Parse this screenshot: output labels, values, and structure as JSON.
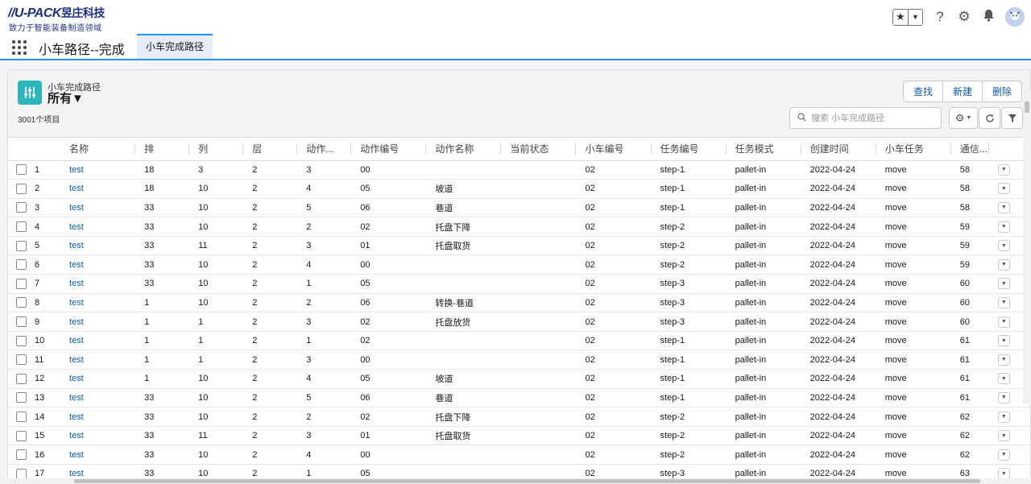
{
  "brand": {
    "name": "U-PACK",
    "name_cn": "昱庄科技",
    "tagline": "致力于智能装备制造领域"
  },
  "header": {
    "star_glyph": "★",
    "dropdown_glyph": "▼",
    "help_glyph": "?",
    "gear_glyph": "⚙",
    "bell_glyph": "🔔"
  },
  "nav": {
    "app_name": "小车路径--完成",
    "active_tab": "小车完成路径"
  },
  "list": {
    "object_type": "小车完成路径",
    "view_name": "所有▼",
    "count": "3001个项目",
    "buttons": {
      "find": "查找",
      "new": "新建",
      "delete": "删除"
    },
    "search_placeholder": "搜索 小车完成路径"
  },
  "table": {
    "columns": [
      "名称",
      "排",
      "列",
      "层",
      "动作...",
      "动作编号",
      "动作名称",
      "当前状态",
      "小车编号",
      "任务编号",
      "任务模式",
      "创建时间",
      "小车任务",
      "通信..."
    ],
    "rows": [
      [
        "1",
        "test",
        "18",
        "3",
        "2",
        "3",
        "00",
        "",
        "",
        "02",
        "step-1",
        "pallet-in",
        "2022-04-24",
        "move",
        "58"
      ],
      [
        "2",
        "test",
        "18",
        "10",
        "2",
        "4",
        "05",
        "坡道",
        "",
        "02",
        "step-1",
        "pallet-in",
        "2022-04-24",
        "move",
        "58"
      ],
      [
        "3",
        "test",
        "33",
        "10",
        "2",
        "5",
        "06",
        "巷道",
        "",
        "02",
        "step-1",
        "pallet-in",
        "2022-04-24",
        "move",
        "58"
      ],
      [
        "4",
        "test",
        "33",
        "10",
        "2",
        "2",
        "02",
        "托盘下降",
        "",
        "02",
        "step-2",
        "pallet-in",
        "2022-04-24",
        "move",
        "59"
      ],
      [
        "5",
        "test",
        "33",
        "11",
        "2",
        "3",
        "01",
        "托盘取货",
        "",
        "02",
        "step-2",
        "pallet-in",
        "2022-04-24",
        "move",
        "59"
      ],
      [
        "6",
        "test",
        "33",
        "10",
        "2",
        "4",
        "00",
        "",
        "",
        "02",
        "step-2",
        "pallet-in",
        "2022-04-24",
        "move",
        "59"
      ],
      [
        "7",
        "test",
        "33",
        "10",
        "2",
        "1",
        "05",
        "",
        "",
        "02",
        "step-3",
        "pallet-in",
        "2022-04-24",
        "move",
        "60"
      ],
      [
        "8",
        "test",
        "1",
        "10",
        "2",
        "2",
        "06",
        "转换-巷道",
        "",
        "02",
        "step-3",
        "pallet-in",
        "2022-04-24",
        "move",
        "60"
      ],
      [
        "9",
        "test",
        "1",
        "1",
        "2",
        "3",
        "02",
        "托盘放货",
        "",
        "02",
        "step-3",
        "pallet-in",
        "2022-04-24",
        "move",
        "60"
      ],
      [
        "10",
        "test",
        "1",
        "1",
        "2",
        "1",
        "02",
        "",
        "",
        "02",
        "step-1",
        "pallet-in",
        "2022-04-24",
        "move",
        "61"
      ],
      [
        "11",
        "test",
        "1",
        "1",
        "2",
        "3",
        "00",
        "",
        "",
        "02",
        "step-1",
        "pallet-in",
        "2022-04-24",
        "move",
        "61"
      ],
      [
        "12",
        "test",
        "1",
        "10",
        "2",
        "4",
        "05",
        "坡道",
        "",
        "02",
        "step-1",
        "pallet-in",
        "2022-04-24",
        "move",
        "61"
      ],
      [
        "13",
        "test",
        "33",
        "10",
        "2",
        "5",
        "06",
        "巷道",
        "",
        "02",
        "step-1",
        "pallet-in",
        "2022-04-24",
        "move",
        "61"
      ],
      [
        "14",
        "test",
        "33",
        "10",
        "2",
        "2",
        "02",
        "托盘下降",
        "",
        "02",
        "step-2",
        "pallet-in",
        "2022-04-24",
        "move",
        "62"
      ],
      [
        "15",
        "test",
        "33",
        "11",
        "2",
        "3",
        "01",
        "托盘取货",
        "",
        "02",
        "step-2",
        "pallet-in",
        "2022-04-24",
        "move",
        "62"
      ],
      [
        "16",
        "test",
        "33",
        "10",
        "2",
        "4",
        "00",
        "",
        "",
        "02",
        "step-2",
        "pallet-in",
        "2022-04-24",
        "move",
        "62"
      ],
      [
        "17",
        "test",
        "33",
        "10",
        "2",
        "1",
        "05",
        "",
        "",
        "02",
        "step-3",
        "pallet-in",
        "2022-04-24",
        "move",
        "63"
      ]
    ]
  },
  "colors": {
    "accent": "#1b96ff",
    "link": "#0b5cab",
    "object_icon": "#2cb5bb",
    "brand": "#1b2f86"
  }
}
